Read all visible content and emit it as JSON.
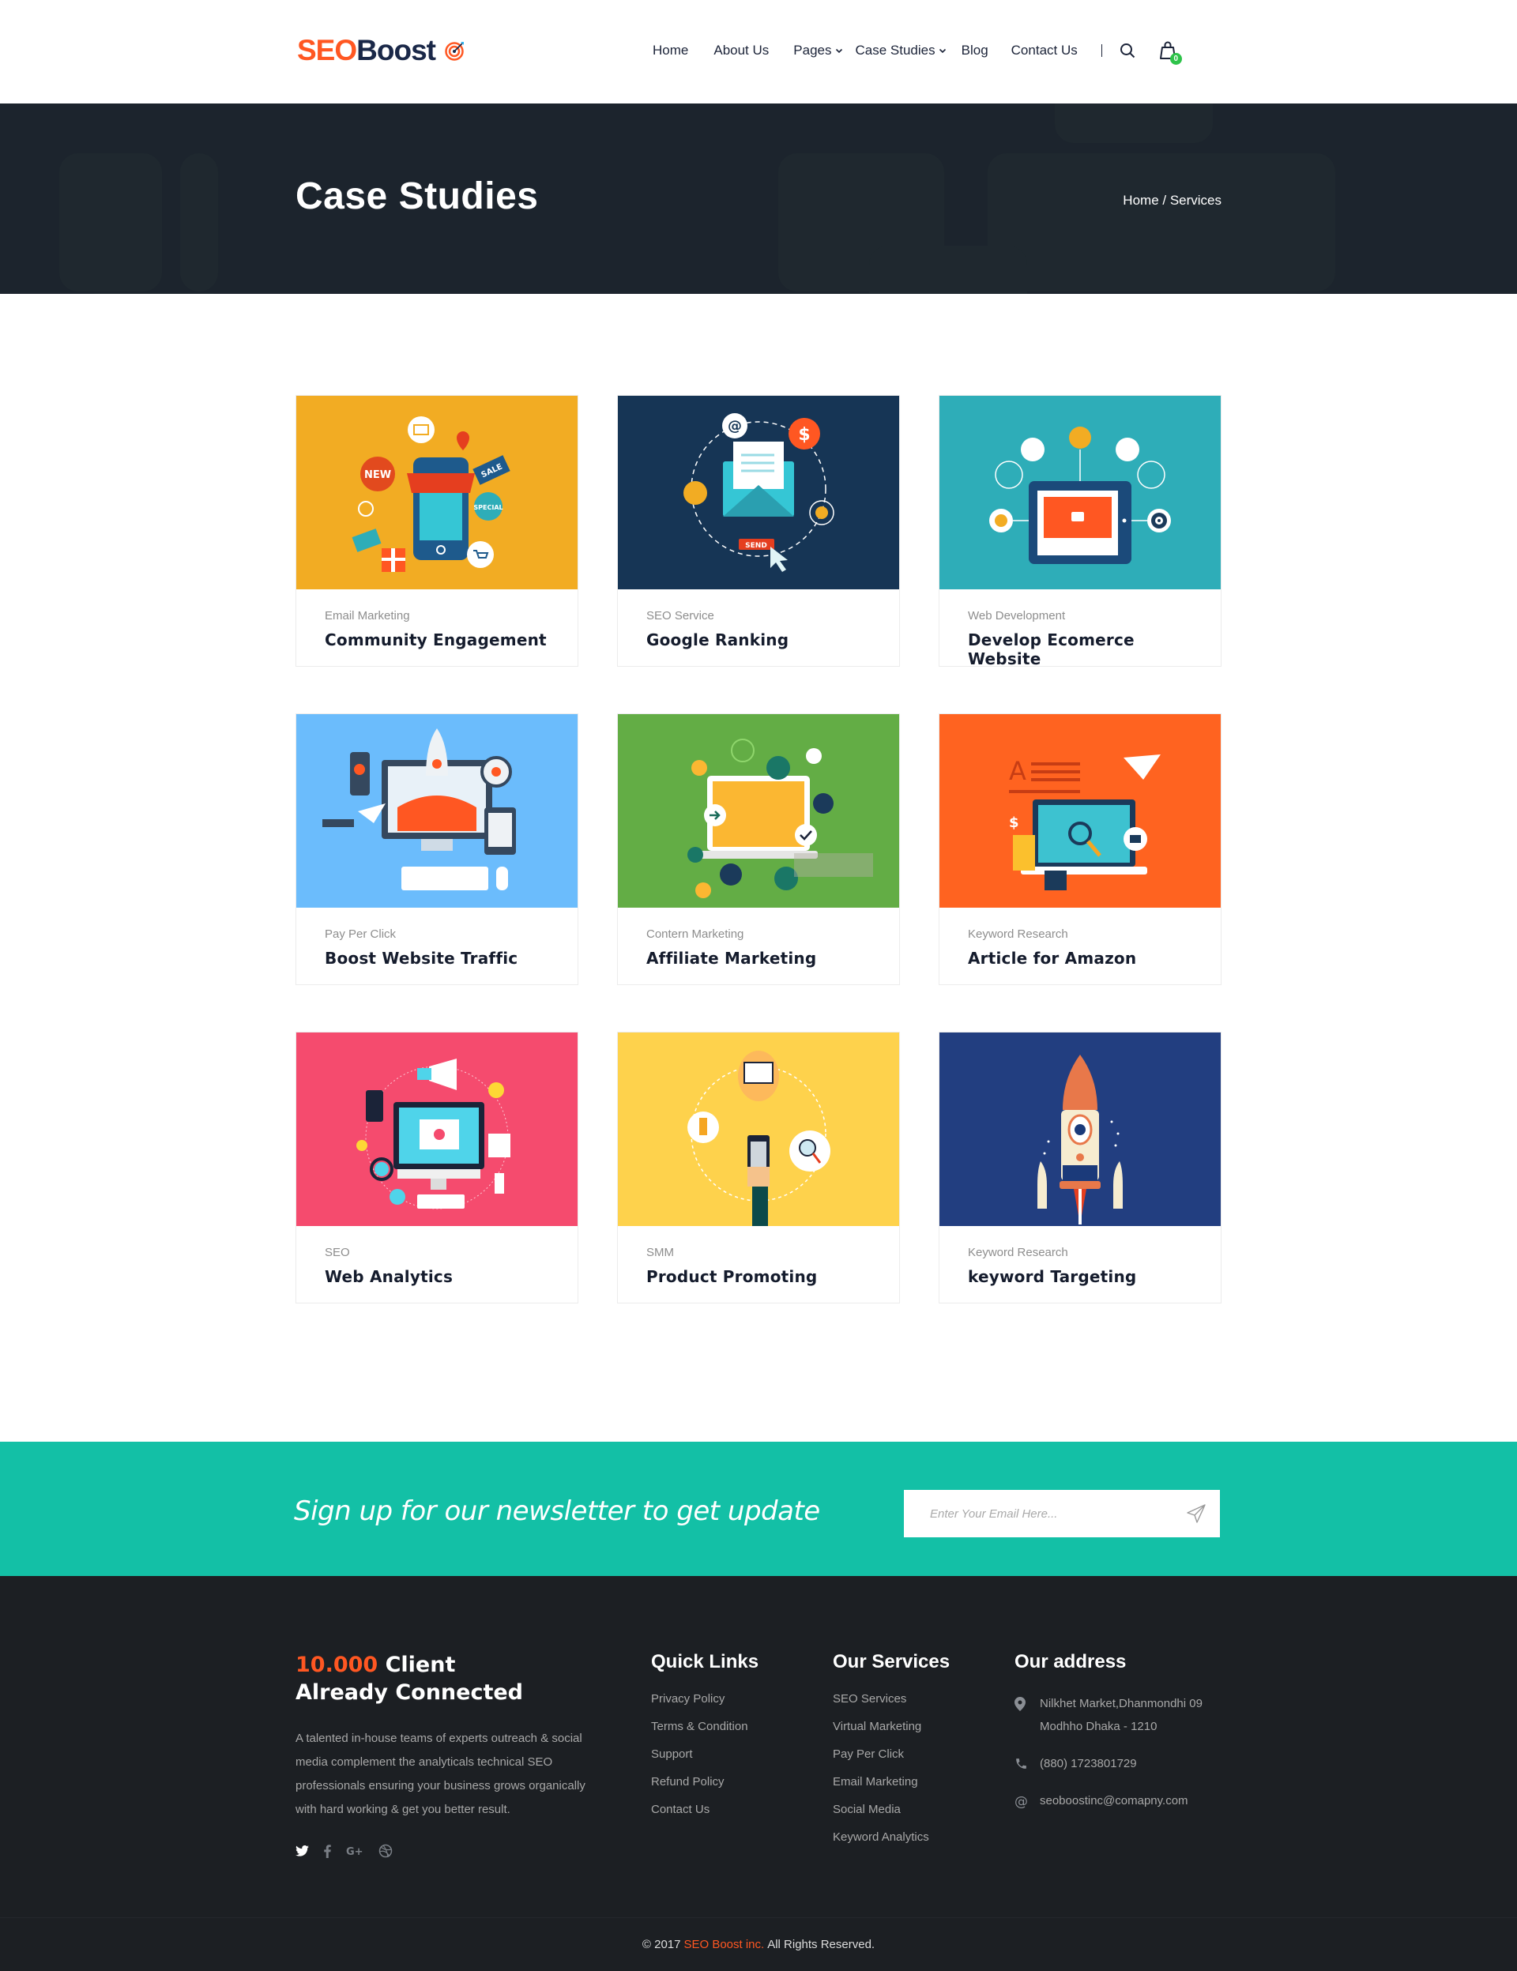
{
  "header": {
    "logo": {
      "part1": "SEO",
      "part2": "Boost"
    },
    "nav": [
      {
        "label": "Home",
        "dropdown": false
      },
      {
        "label": "About Us",
        "dropdown": false
      },
      {
        "label": "Pages",
        "dropdown": true
      },
      {
        "label": "Case Studies",
        "dropdown": true
      },
      {
        "label": "Blog",
        "dropdown": false
      },
      {
        "label": "Contact Us",
        "dropdown": false
      }
    ],
    "search_icon": "search-icon",
    "cart_icon": "shopping-bag-icon",
    "cart_count": "0"
  },
  "hero": {
    "title": "Case Studies",
    "breadcrumb": "Home / Services"
  },
  "cards": [
    {
      "category": "Email Marketing",
      "title": "Community Engagement",
      "bg": "#f2ac23",
      "illustration": "mobile-shop"
    },
    {
      "category": "SEO Service",
      "title": "Google Ranking",
      "bg": "#163555",
      "illustration": "email-send"
    },
    {
      "category": "Web Development",
      "title": "Develop Ecomerce Website",
      "bg": "#2eadb8",
      "illustration": "tablet-video"
    },
    {
      "category": "Pay Per Click",
      "title": "Boost Website Traffic",
      "bg": "#6bbcfc",
      "illustration": "rocket-desktop"
    },
    {
      "category": "Contern Marketing",
      "title": "Affiliate Marketing",
      "bg": "#63ad45",
      "illustration": "laptop-icons"
    },
    {
      "category": "Keyword Research",
      "title": "Article for Amazon",
      "bg": "#ff6320",
      "illustration": "laptop-map"
    },
    {
      "category": "SEO",
      "title": "Web Analytics",
      "bg": "#f54b6e",
      "illustration": "monitor-megaphone"
    },
    {
      "category": "SMM",
      "title": "Product Promoting",
      "bg": "#fed24c",
      "illustration": "phone-hand"
    },
    {
      "category": "Keyword Research",
      "title": "keyword Targeting",
      "bg": "#223e80",
      "illustration": "rocket"
    }
  ],
  "newsletter": {
    "text": "Sign up for our newsletter to get update",
    "placeholder": "Enter Your Email Here...",
    "send_icon": "paper-plane-icon"
  },
  "footer": {
    "headline_accent": "10.000",
    "headline_rest": " Client",
    "headline_line2": "Already Connected",
    "description": "A talented in-house teams of experts outreach & social media complement the analyticals technical SEO professionals ensuring your business grows organically with hard working & get you better result.",
    "social": [
      "twitter-icon",
      "facebook-icon",
      "google-plus-icon",
      "dribbble-icon"
    ],
    "quick_links": {
      "heading": "Quick Links",
      "items": [
        "Privacy Policy",
        "Terms & Condition",
        "Support",
        "Refund Policy",
        "Contact Us"
      ]
    },
    "services": {
      "heading": "Our Services",
      "items": [
        "SEO Services",
        "Virtual Marketing",
        "Pay Per Click",
        "Email Marketing",
        "Social Media",
        "Keyword Analytics"
      ]
    },
    "address": {
      "heading": "Our address",
      "line1": "Nilkhet Market,Dhanmondhi 09",
      "line2": "Modhho Dhaka - 1210",
      "phone": "(880) 1723801729",
      "email": "seoboostinc@comapny.com"
    },
    "copyright": {
      "prefix": "© 2017",
      "brand": "SEO Boost inc.",
      "suffix": "All Rights Reserved."
    }
  }
}
